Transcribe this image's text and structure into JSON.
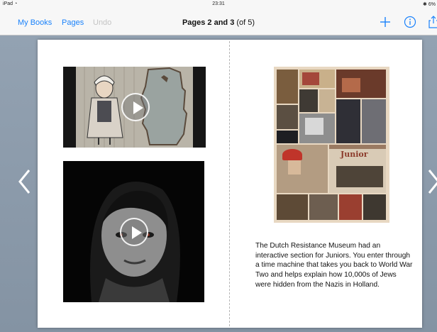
{
  "status_bar": {
    "device": "iPad",
    "time": "23:31",
    "battery": "6%"
  },
  "nav": {
    "my_books": "My Books",
    "pages": "Pages",
    "undo": "Undo",
    "title_bold": "Pages 2 and 3",
    "title_rest": "(of 5)",
    "icons": [
      "plus-icon",
      "info-icon",
      "share-icon"
    ]
  },
  "page_right": {
    "collage_sign_text": "Junior",
    "caption": "The Dutch Resistance Museum had an interactive section for Juniors.  You enter through a time machine that takes you back to World War Two and helps explain how 10,000s of Jews were hidden from the Nazis in Holland."
  },
  "colors": {
    "accent": "#1a82fb",
    "page": "#ffffff",
    "background": "#8a9aab"
  }
}
